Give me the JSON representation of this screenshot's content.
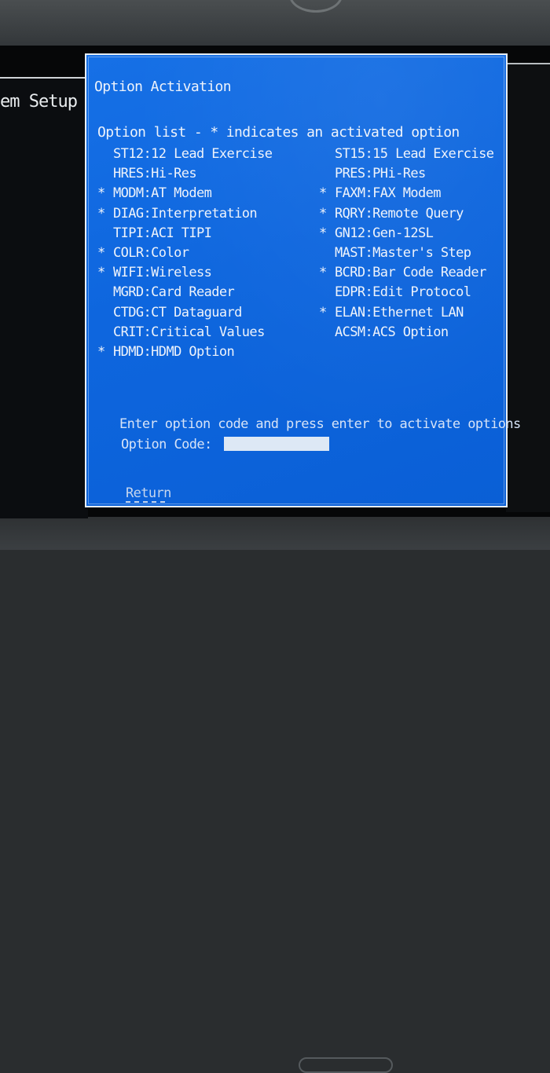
{
  "background_window": {
    "title_fragment": "em Setup"
  },
  "dialog": {
    "title": "Option Activation",
    "list_header": "Option list - * indicates an activated option",
    "left_options": [
      {
        "active": false,
        "label": "ST12:12 Lead Exercise"
      },
      {
        "active": false,
        "label": "HRES:Hi-Res"
      },
      {
        "active": true,
        "label": "MODM:AT Modem"
      },
      {
        "active": true,
        "label": "DIAG:Interpretation"
      },
      {
        "active": false,
        "label": "TIPI:ACI TIPI"
      },
      {
        "active": true,
        "label": "COLR:Color"
      },
      {
        "active": true,
        "label": "WIFI:Wireless"
      },
      {
        "active": false,
        "label": "MGRD:Card Reader"
      },
      {
        "active": false,
        "label": "CTDG:CT Dataguard"
      },
      {
        "active": false,
        "label": "CRIT:Critical Values"
      },
      {
        "active": true,
        "label": "HDMD:HDMD Option"
      }
    ],
    "right_options": [
      {
        "active": false,
        "label": "ST15:15 Lead Exercise"
      },
      {
        "active": false,
        "label": "PRES:PHi-Res"
      },
      {
        "active": true,
        "label": "FAXM:FAX Modem"
      },
      {
        "active": true,
        "label": "RQRY:Remote Query"
      },
      {
        "active": true,
        "label": "GN12:Gen-12SL"
      },
      {
        "active": false,
        "label": "MAST:Master's Step"
      },
      {
        "active": true,
        "label": "BCRD:Bar Code Reader"
      },
      {
        "active": false,
        "label": "EDPR:Edit Protocol"
      },
      {
        "active": true,
        "label": "ELAN:Ethernet LAN"
      },
      {
        "active": false,
        "label": "ACSM:ACS Option"
      }
    ],
    "active_marker": "*",
    "prompt": "Enter option code and press enter to activate options",
    "code_label": "Option Code:",
    "code_value": "",
    "return_label": "Return"
  },
  "colors": {
    "dialog_blue": "#0e66de",
    "text": "#eef3fb",
    "input_bg": "#dde8f5"
  }
}
